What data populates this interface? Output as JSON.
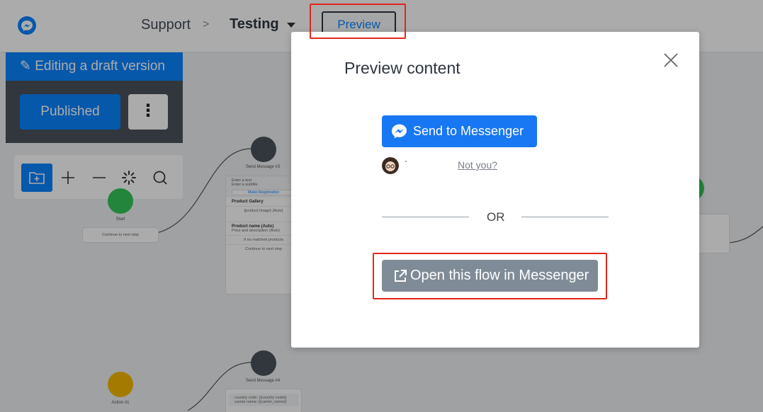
{
  "header": {
    "breadcrumb_support": "Support",
    "breadcrumb_separator": ">",
    "breadcrumb_testing": "Testing",
    "preview_label": "Preview"
  },
  "draft_panel": {
    "editing_label": "Editing a draft version",
    "published_label": "Published",
    "more_label": "⋮"
  },
  "toolbox": {
    "tools": [
      "folder-add-icon",
      "zoom-in-icon",
      "zoom-out-icon",
      "loading-icon",
      "search-icon"
    ]
  },
  "flow": {
    "nodes": [
      {
        "label": "Start",
        "footer": "Continue to next step"
      },
      {
        "label": "Send Message #3",
        "lines": [
          "Enter a text",
          "Enter a subtitle"
        ],
        "button": "Make Registration",
        "gallery": "Product Gallery",
        "image": "{product image} (Auto)",
        "name": "Product name (Auto)",
        "desc": "Price and description (Auto)",
        "empty": "If no matched products",
        "footer": "Continue to next step"
      },
      {
        "label": "Action #1"
      },
      {
        "label": "Send Message #4",
        "lines": [
          "country code: {{country code}}",
          "carrier name: {{carrier_name}}"
        ]
      }
    ]
  },
  "modal": {
    "title": "Preview content",
    "send_button": "Send to Messenger",
    "user_name": "`",
    "not_you": "Not you?",
    "or_label": "OR",
    "open_button": "Open this flow in Messenger"
  },
  "colors": {
    "accent": "#0a84ff",
    "messenger_blue": "#1877f2",
    "highlight_red": "#e3261c",
    "open_button_gray": "#7f8c97"
  }
}
